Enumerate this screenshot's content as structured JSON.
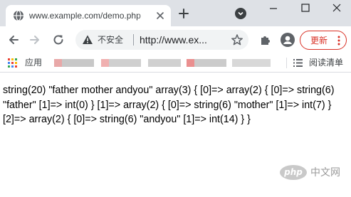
{
  "tab": {
    "title": "www.example.com/demo.php",
    "favicon": "globe-icon"
  },
  "window_controls": [
    "minimize-icon",
    "maximize-icon",
    "close-icon"
  ],
  "toolbar": {
    "security_label": "不安全",
    "url": "http://www.ex...",
    "update_label": "更新"
  },
  "bookmarks": {
    "apps_label": "应用",
    "reading_list_label": "阅读清单",
    "blurred_items": [
      {
        "colors": [
          "#e8a8a8",
          "#c8c8c8"
        ]
      },
      {
        "colors": [
          "#f0b0b0",
          "#cfcfcf"
        ]
      },
      {
        "colors": [
          "#c9c9c9",
          "#d6d6d6"
        ]
      },
      {
        "colors": [
          "#ea8f8f",
          "#cbcbcb"
        ]
      },
      {
        "colors": [
          "#d2d2d2",
          "#dcdcdc"
        ]
      }
    ]
  },
  "page": {
    "content": "string(20) \"father mother andyou\" array(3) { [0]=> array(2) { [0]=> string(6) \"father\" [1]=> int(0) } [1]=> array(2) { [0]=> string(6) \"mother\" [1]=> int(7) } [2]=> array(2) { [0]=> string(6) \"andyou\" [1]=> int(14) } }"
  },
  "watermark": {
    "logo": "php",
    "site": "中文网"
  },
  "colors": {
    "tab_strip": "#dee1e6",
    "omnibox": "#f1f3f4",
    "update_accent": "#d93025",
    "text": "#000000"
  }
}
